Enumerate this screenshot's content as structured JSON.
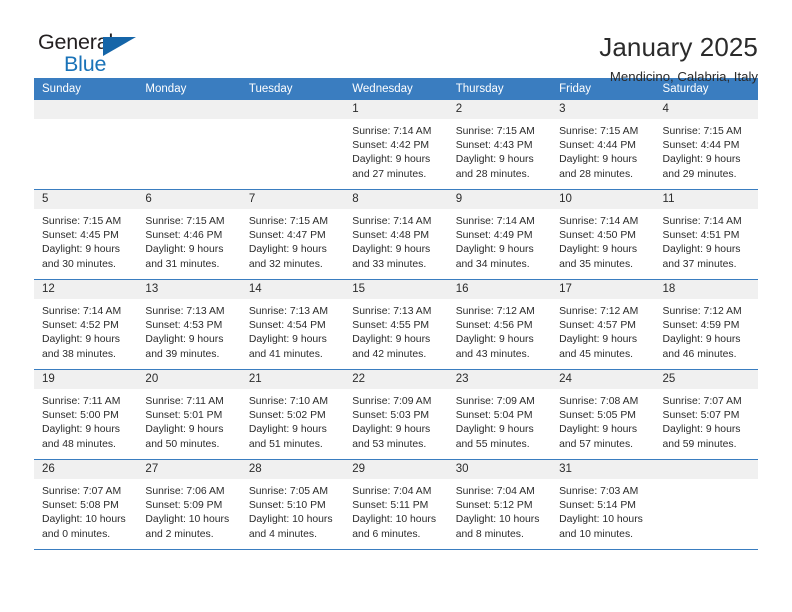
{
  "brand": {
    "name_part1": "General",
    "name_part2": "Blue",
    "triangle_icon": "blue-triangle-icon",
    "color_dark": "#231f20",
    "color_blue": "#1a73b8"
  },
  "header": {
    "title": "January 2025",
    "subtitle": "Mendicino, Calabria, Italy"
  },
  "theme": {
    "header_blue": "#3a7dc0",
    "date_strip_gray": "#f0f0f0",
    "text_dark": "#2b2b2b"
  },
  "weekdays": [
    "Sunday",
    "Monday",
    "Tuesday",
    "Wednesday",
    "Thursday",
    "Friday",
    "Saturday"
  ],
  "weeks": [
    [
      {
        "date": "",
        "sunrise": "",
        "sunset": "",
        "daylight_line1": "",
        "daylight_line2": ""
      },
      {
        "date": "",
        "sunrise": "",
        "sunset": "",
        "daylight_line1": "",
        "daylight_line2": ""
      },
      {
        "date": "",
        "sunrise": "",
        "sunset": "",
        "daylight_line1": "",
        "daylight_line2": ""
      },
      {
        "date": "1",
        "sunrise": "Sunrise: 7:14 AM",
        "sunset": "Sunset: 4:42 PM",
        "daylight_line1": "Daylight: 9 hours",
        "daylight_line2": "and 27 minutes."
      },
      {
        "date": "2",
        "sunrise": "Sunrise: 7:15 AM",
        "sunset": "Sunset: 4:43 PM",
        "daylight_line1": "Daylight: 9 hours",
        "daylight_line2": "and 28 minutes."
      },
      {
        "date": "3",
        "sunrise": "Sunrise: 7:15 AM",
        "sunset": "Sunset: 4:44 PM",
        "daylight_line1": "Daylight: 9 hours",
        "daylight_line2": "and 28 minutes."
      },
      {
        "date": "4",
        "sunrise": "Sunrise: 7:15 AM",
        "sunset": "Sunset: 4:44 PM",
        "daylight_line1": "Daylight: 9 hours",
        "daylight_line2": "and 29 minutes."
      }
    ],
    [
      {
        "date": "5",
        "sunrise": "Sunrise: 7:15 AM",
        "sunset": "Sunset: 4:45 PM",
        "daylight_line1": "Daylight: 9 hours",
        "daylight_line2": "and 30 minutes."
      },
      {
        "date": "6",
        "sunrise": "Sunrise: 7:15 AM",
        "sunset": "Sunset: 4:46 PM",
        "daylight_line1": "Daylight: 9 hours",
        "daylight_line2": "and 31 minutes."
      },
      {
        "date": "7",
        "sunrise": "Sunrise: 7:15 AM",
        "sunset": "Sunset: 4:47 PM",
        "daylight_line1": "Daylight: 9 hours",
        "daylight_line2": "and 32 minutes."
      },
      {
        "date": "8",
        "sunrise": "Sunrise: 7:14 AM",
        "sunset": "Sunset: 4:48 PM",
        "daylight_line1": "Daylight: 9 hours",
        "daylight_line2": "and 33 minutes."
      },
      {
        "date": "9",
        "sunrise": "Sunrise: 7:14 AM",
        "sunset": "Sunset: 4:49 PM",
        "daylight_line1": "Daylight: 9 hours",
        "daylight_line2": "and 34 minutes."
      },
      {
        "date": "10",
        "sunrise": "Sunrise: 7:14 AM",
        "sunset": "Sunset: 4:50 PM",
        "daylight_line1": "Daylight: 9 hours",
        "daylight_line2": "and 35 minutes."
      },
      {
        "date": "11",
        "sunrise": "Sunrise: 7:14 AM",
        "sunset": "Sunset: 4:51 PM",
        "daylight_line1": "Daylight: 9 hours",
        "daylight_line2": "and 37 minutes."
      }
    ],
    [
      {
        "date": "12",
        "sunrise": "Sunrise: 7:14 AM",
        "sunset": "Sunset: 4:52 PM",
        "daylight_line1": "Daylight: 9 hours",
        "daylight_line2": "and 38 minutes."
      },
      {
        "date": "13",
        "sunrise": "Sunrise: 7:13 AM",
        "sunset": "Sunset: 4:53 PM",
        "daylight_line1": "Daylight: 9 hours",
        "daylight_line2": "and 39 minutes."
      },
      {
        "date": "14",
        "sunrise": "Sunrise: 7:13 AM",
        "sunset": "Sunset: 4:54 PM",
        "daylight_line1": "Daylight: 9 hours",
        "daylight_line2": "and 41 minutes."
      },
      {
        "date": "15",
        "sunrise": "Sunrise: 7:13 AM",
        "sunset": "Sunset: 4:55 PM",
        "daylight_line1": "Daylight: 9 hours",
        "daylight_line2": "and 42 minutes."
      },
      {
        "date": "16",
        "sunrise": "Sunrise: 7:12 AM",
        "sunset": "Sunset: 4:56 PM",
        "daylight_line1": "Daylight: 9 hours",
        "daylight_line2": "and 43 minutes."
      },
      {
        "date": "17",
        "sunrise": "Sunrise: 7:12 AM",
        "sunset": "Sunset: 4:57 PM",
        "daylight_line1": "Daylight: 9 hours",
        "daylight_line2": "and 45 minutes."
      },
      {
        "date": "18",
        "sunrise": "Sunrise: 7:12 AM",
        "sunset": "Sunset: 4:59 PM",
        "daylight_line1": "Daylight: 9 hours",
        "daylight_line2": "and 46 minutes."
      }
    ],
    [
      {
        "date": "19",
        "sunrise": "Sunrise: 7:11 AM",
        "sunset": "Sunset: 5:00 PM",
        "daylight_line1": "Daylight: 9 hours",
        "daylight_line2": "and 48 minutes."
      },
      {
        "date": "20",
        "sunrise": "Sunrise: 7:11 AM",
        "sunset": "Sunset: 5:01 PM",
        "daylight_line1": "Daylight: 9 hours",
        "daylight_line2": "and 50 minutes."
      },
      {
        "date": "21",
        "sunrise": "Sunrise: 7:10 AM",
        "sunset": "Sunset: 5:02 PM",
        "daylight_line1": "Daylight: 9 hours",
        "daylight_line2": "and 51 minutes."
      },
      {
        "date": "22",
        "sunrise": "Sunrise: 7:09 AM",
        "sunset": "Sunset: 5:03 PM",
        "daylight_line1": "Daylight: 9 hours",
        "daylight_line2": "and 53 minutes."
      },
      {
        "date": "23",
        "sunrise": "Sunrise: 7:09 AM",
        "sunset": "Sunset: 5:04 PM",
        "daylight_line1": "Daylight: 9 hours",
        "daylight_line2": "and 55 minutes."
      },
      {
        "date": "24",
        "sunrise": "Sunrise: 7:08 AM",
        "sunset": "Sunset: 5:05 PM",
        "daylight_line1": "Daylight: 9 hours",
        "daylight_line2": "and 57 minutes."
      },
      {
        "date": "25",
        "sunrise": "Sunrise: 7:07 AM",
        "sunset": "Sunset: 5:07 PM",
        "daylight_line1": "Daylight: 9 hours",
        "daylight_line2": "and 59 minutes."
      }
    ],
    [
      {
        "date": "26",
        "sunrise": "Sunrise: 7:07 AM",
        "sunset": "Sunset: 5:08 PM",
        "daylight_line1": "Daylight: 10 hours",
        "daylight_line2": "and 0 minutes."
      },
      {
        "date": "27",
        "sunrise": "Sunrise: 7:06 AM",
        "sunset": "Sunset: 5:09 PM",
        "daylight_line1": "Daylight: 10 hours",
        "daylight_line2": "and 2 minutes."
      },
      {
        "date": "28",
        "sunrise": "Sunrise: 7:05 AM",
        "sunset": "Sunset: 5:10 PM",
        "daylight_line1": "Daylight: 10 hours",
        "daylight_line2": "and 4 minutes."
      },
      {
        "date": "29",
        "sunrise": "Sunrise: 7:04 AM",
        "sunset": "Sunset: 5:11 PM",
        "daylight_line1": "Daylight: 10 hours",
        "daylight_line2": "and 6 minutes."
      },
      {
        "date": "30",
        "sunrise": "Sunrise: 7:04 AM",
        "sunset": "Sunset: 5:12 PM",
        "daylight_line1": "Daylight: 10 hours",
        "daylight_line2": "and 8 minutes."
      },
      {
        "date": "31",
        "sunrise": "Sunrise: 7:03 AM",
        "sunset": "Sunset: 5:14 PM",
        "daylight_line1": "Daylight: 10 hours",
        "daylight_line2": "and 10 minutes."
      },
      {
        "date": "",
        "sunrise": "",
        "sunset": "",
        "daylight_line1": "",
        "daylight_line2": ""
      }
    ]
  ]
}
